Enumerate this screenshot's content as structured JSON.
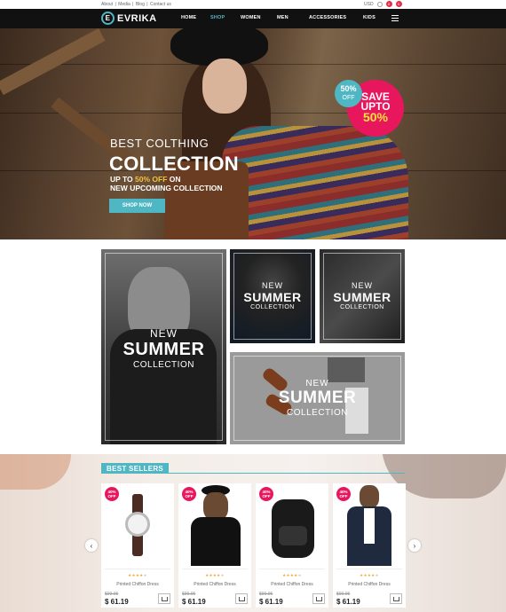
{
  "topbar": {
    "links": [
      "About",
      "Media",
      "Blog",
      "Contact us"
    ],
    "currency": "USD",
    "badges": [
      "0",
      "0"
    ]
  },
  "nav": {
    "brand_letter": "E",
    "brand": "EVRIKA",
    "items": [
      "HOME",
      "SHOP",
      "WOMEN",
      "MEN",
      "ACCESSORIES",
      "KIDS"
    ],
    "active": "SHOP",
    "menu_icon": "hamburger-icon"
  },
  "hero": {
    "line1": "BEST COLTHING",
    "line2": "COLLECTION",
    "line3_pre": "UP TO ",
    "line3_hl": "50% OFF",
    "line3_post": " ON",
    "line4": "NEW UPCOMING COLLECTION",
    "button": "SHOP NOW",
    "badge_pct": "50%",
    "badge_off": "OFF",
    "save_line1": "SAVE",
    "save_line2": "UPTO",
    "save_pct": "50%"
  },
  "collections": [
    {
      "new": "NEW",
      "title": "SUMMER",
      "sub": "COLLECTION"
    },
    {
      "new": "NEW",
      "title": "SUMMER",
      "sub": "COLLECTION"
    },
    {
      "new": "NEW",
      "title": "SUMMER",
      "sub": "COLLECTION"
    },
    {
      "new": "NEW",
      "title": "SUMMER",
      "sub": "COLLECTION"
    }
  ],
  "best_sellers": {
    "title": "BEST SELLERS",
    "prev_icon": "chevron-left-icon",
    "next_icon": "chevron-right-icon",
    "products": [
      {
        "sale": "40%",
        "sale_sub": "OFF",
        "name": "Printed Chiffon Dress",
        "old": "$99.95",
        "price": "$ 61.19",
        "rating": 4
      },
      {
        "sale": "40%",
        "sale_sub": "OFF",
        "name": "Printed Chiffon Dress",
        "old": "$99.95",
        "price": "$ 61.19",
        "rating": 4
      },
      {
        "sale": "40%",
        "sale_sub": "OFF",
        "name": "Printed Chiffon Dress",
        "old": "$99.95",
        "price": "$ 61.19",
        "rating": 4
      },
      {
        "sale": "40%",
        "sale_sub": "OFF",
        "name": "Printed Chiffon Dress",
        "old": "$99.95",
        "price": "$ 61.19",
        "rating": 4
      }
    ]
  },
  "colors": {
    "accent": "#4fb7c4",
    "sale": "#e8175d",
    "nav_bg": "#111111"
  }
}
